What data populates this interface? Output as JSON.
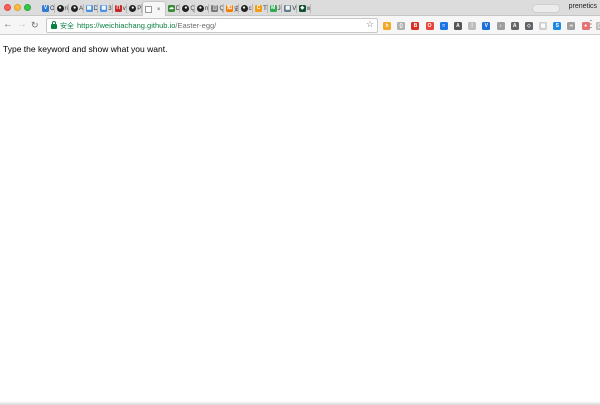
{
  "window": {
    "traffic_lights": [
      "close",
      "minimize",
      "zoom"
    ],
    "profile_name": "prenetics"
  },
  "tabs": [
    {
      "label": "Or",
      "icon": "v-brand-icon",
      "color": "#2f7bd6",
      "glyph": "V"
    },
    {
      "label": "rib",
      "icon": "github-icon",
      "color": "#222222",
      "glyph": "●"
    },
    {
      "label": "An",
      "icon": "github-icon",
      "color": "#222222",
      "glyph": "●"
    },
    {
      "label": "Da",
      "icon": "site-icon",
      "color": "#4a90e2",
      "glyph": "▦"
    },
    {
      "label": "3D",
      "icon": "site-icon",
      "color": "#4a90e2",
      "glyph": "▦"
    },
    {
      "label": "vu",
      "icon": "red-box-icon",
      "color": "#c62828",
      "glyph": "Π"
    },
    {
      "label": "Pr",
      "icon": "github-icon",
      "color": "#222222",
      "glyph": "●"
    },
    {
      "label": "",
      "icon": "document-icon",
      "color": "#ffffff",
      "glyph": "",
      "active": true
    },
    {
      "label": "De",
      "icon": "cloud-icon",
      "color": "#3a8a3a",
      "glyph": "☁"
    },
    {
      "label": "Qi",
      "icon": "github-icon",
      "color": "#222222",
      "glyph": "●"
    },
    {
      "label": "ns",
      "icon": "github-icon",
      "color": "#222222",
      "glyph": "●"
    },
    {
      "label": "Qu",
      "icon": "bracket-icon",
      "color": "#777777",
      "glyph": "[]"
    },
    {
      "label": "史",
      "icon": "orange-box-icon",
      "color": "#f57c00",
      "glyph": "知"
    },
    {
      "label": "ch",
      "icon": "github-icon",
      "color": "#222222",
      "glyph": "●"
    },
    {
      "label": "Ti",
      "icon": "orange-c-icon",
      "color": "#f39c12",
      "glyph": "C"
    },
    {
      "label": "Jo",
      "icon": "map-icon",
      "color": "#34a853",
      "glyph": "M"
    },
    {
      "label": "Vic",
      "icon": "site-icon",
      "color": "#607d8b",
      "glyph": "▦"
    },
    {
      "label": "we",
      "icon": "green-dark-icon",
      "color": "#0f5132",
      "glyph": "◆"
    }
  ],
  "active_tab_close": "×",
  "toolbar": {
    "back": "←",
    "forward": "→",
    "reload": "↻",
    "secure_label": "安全",
    "url_host": "https://weichiachang.github.io",
    "url_path": "/Easter-egg/",
    "star": "☆",
    "menu": "⋮",
    "extensions": [
      {
        "name": "honey-icon",
        "color": "#f5a623",
        "glyph": "h"
      },
      {
        "name": "bracket-ext-icon",
        "color": "#b0b0b0",
        "glyph": "()"
      },
      {
        "name": "red-ext-icon",
        "color": "#d93025",
        "glyph": "B"
      },
      {
        "name": "opera-icon",
        "color": "#e8453c",
        "glyph": "O"
      },
      {
        "name": "wifi-icon",
        "color": "#1a73e8",
        "glyph": "≈"
      },
      {
        "name": "adblock-icon",
        "color": "#555555",
        "glyph": "A"
      },
      {
        "name": "lamp-icon",
        "color": "#bdbdbd",
        "glyph": "!"
      },
      {
        "name": "vue-icon",
        "color": "#1e6fd9",
        "glyph": "V"
      },
      {
        "name": "mic-icon",
        "color": "#9e9e9e",
        "glyph": "♪"
      },
      {
        "name": "a-circle-icon",
        "color": "#666666",
        "glyph": "A"
      },
      {
        "name": "shield-icon",
        "color": "#5f6368",
        "glyph": "◇"
      },
      {
        "name": "grid-icon",
        "color": "#cfcfcf",
        "glyph": "▦"
      },
      {
        "name": "s-icon",
        "color": "#1e88e5",
        "glyph": "S"
      },
      {
        "name": "link-icon",
        "color": "#9e9e9e",
        "glyph": "∞"
      },
      {
        "name": "ball-icon",
        "color": "#e57373",
        "glyph": "●"
      },
      {
        "name": "puzzle-icon",
        "color": "#bdbdbd",
        "glyph": "▢"
      }
    ]
  },
  "page": {
    "text": "Type the keyword and show what you want."
  }
}
